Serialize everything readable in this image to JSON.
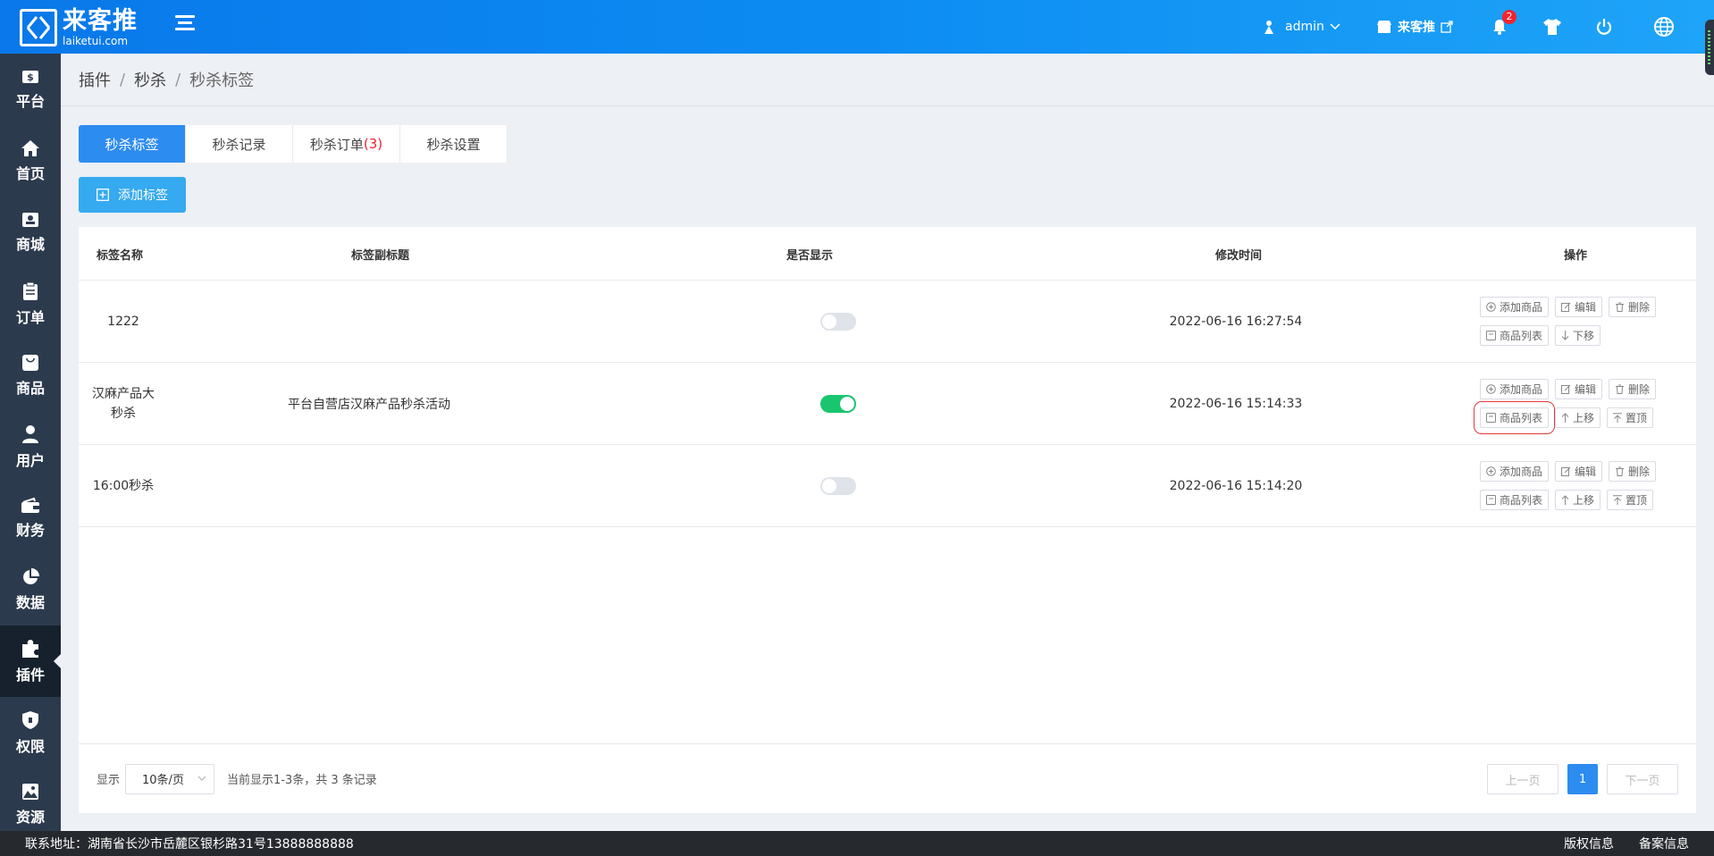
{
  "header": {
    "logo_name": "来客推",
    "logo_domain": "laiketui.com",
    "user": "admin",
    "shop": "来客推",
    "notifications": "2"
  },
  "sidebar": {
    "items": [
      {
        "label": "平台",
        "icon": "dollar-icon"
      },
      {
        "label": "首页",
        "icon": "home-icon"
      },
      {
        "label": "商城",
        "icon": "store-icon"
      },
      {
        "label": "订单",
        "icon": "clipboard-icon"
      },
      {
        "label": "商品",
        "icon": "bag-icon"
      },
      {
        "label": "用户",
        "icon": "user-icon"
      },
      {
        "label": "财务",
        "icon": "wallet-icon"
      },
      {
        "label": "数据",
        "icon": "pie-icon"
      },
      {
        "label": "插件",
        "icon": "puzzle-icon"
      },
      {
        "label": "权限",
        "icon": "shield-icon"
      },
      {
        "label": "资源",
        "icon": "image-icon"
      }
    ],
    "active": "插件"
  },
  "breadcrumb": [
    "插件",
    "秒杀",
    "秒杀标签"
  ],
  "tabs": [
    {
      "label": "秒杀标签"
    },
    {
      "label": "秒杀记录"
    },
    {
      "label": "秒杀订单",
      "count": "(3)"
    },
    {
      "label": "秒杀设置"
    }
  ],
  "add_button": "添加标签",
  "table": {
    "columns": [
      "标签名称",
      "标签副标题",
      "是否显示",
      "修改时间",
      "操作"
    ],
    "rows": [
      {
        "name": "1222",
        "subtitle": "",
        "show": false,
        "time": "2022-06-16 16:27:54",
        "ops1": [
          "添加商品",
          "编辑",
          "删除"
        ],
        "ops2": [
          "商品列表",
          "下移"
        ]
      },
      {
        "name": "汉麻产品大秒杀",
        "subtitle": "平台自营店汉麻产品秒杀活动",
        "show": true,
        "time": "2022-06-16 15:14:33",
        "ops1": [
          "添加商品",
          "编辑",
          "删除"
        ],
        "ops2": [
          "商品列表",
          "上移",
          "置顶"
        ]
      },
      {
        "name": "16:00秒杀",
        "subtitle": "",
        "show": false,
        "time": "2022-06-16 15:14:20",
        "ops1": [
          "添加商品",
          "编辑",
          "删除"
        ],
        "ops2": [
          "商品列表",
          "上移",
          "置顶"
        ]
      }
    ]
  },
  "pagination": {
    "show_label": "显示",
    "page_size": "10条/页",
    "summary": "当前显示1-3条，共 3 条记录",
    "prev": "上一页",
    "current": "1",
    "next": "下一页"
  },
  "footer": {
    "address": "联系地址：湖南省长沙市岳麓区银杉路31号13888888888",
    "copyright": "版权信息",
    "record": "备案信息"
  },
  "colors": {
    "primary": "#2d8cf0",
    "header": "#0c8cf2",
    "sidebar": "#2c3a4d",
    "switch_on": "#19c66f",
    "badge": "#f5222d"
  }
}
